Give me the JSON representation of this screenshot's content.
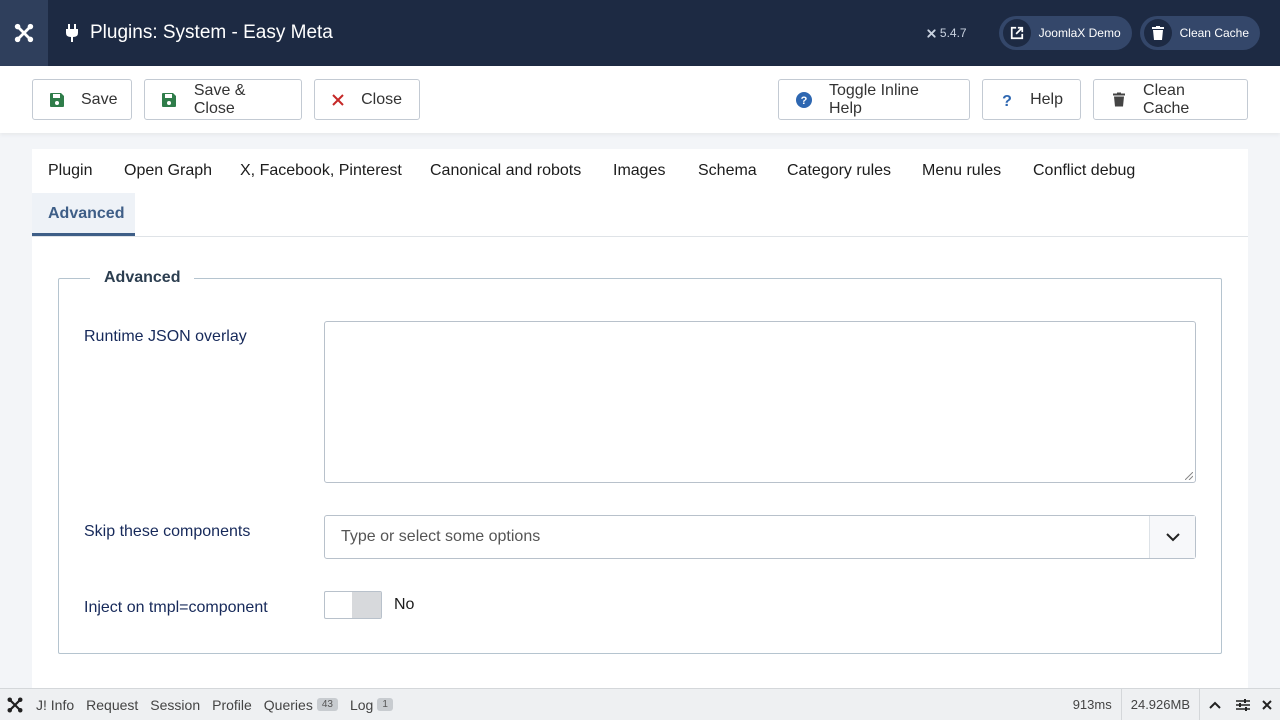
{
  "header": {
    "title": "Plugins: System - Easy Meta",
    "version": "5.4.7",
    "site_button": "JoomlaX Demo",
    "cache_button": "Clean Cache",
    "bg_color": "#1d2a43"
  },
  "toolbar": {
    "save": "Save",
    "save_close": "Save & Close",
    "close": "Close",
    "toggle_help": "Toggle Inline Help",
    "help": "Help",
    "clean_cache": "Clean Cache"
  },
  "tabs": [
    {
      "label": "Plugin"
    },
    {
      "label": "Open Graph"
    },
    {
      "label": "X, Facebook, Pinterest"
    },
    {
      "label": "Canonical and robots"
    },
    {
      "label": "Images"
    },
    {
      "label": "Schema"
    },
    {
      "label": "Category rules"
    },
    {
      "label": "Menu rules"
    },
    {
      "label": "Conflict debug"
    },
    {
      "label": "Advanced",
      "active": true
    }
  ],
  "advanced": {
    "legend": "Advanced",
    "runtime_json_label": "Runtime JSON overlay",
    "runtime_json_value": "",
    "skip_components_label": "Skip these components",
    "skip_components_placeholder": "Type or select some options",
    "inject_label": "Inject on tmpl=component",
    "inject_value": "No"
  },
  "debugbar": {
    "info": "J! Info",
    "request": "Request",
    "session": "Session",
    "profile": "Profile",
    "queries": "Queries",
    "queries_count": "43",
    "log": "Log",
    "log_count": "1",
    "time": "913ms",
    "memory": "24.926MB"
  }
}
